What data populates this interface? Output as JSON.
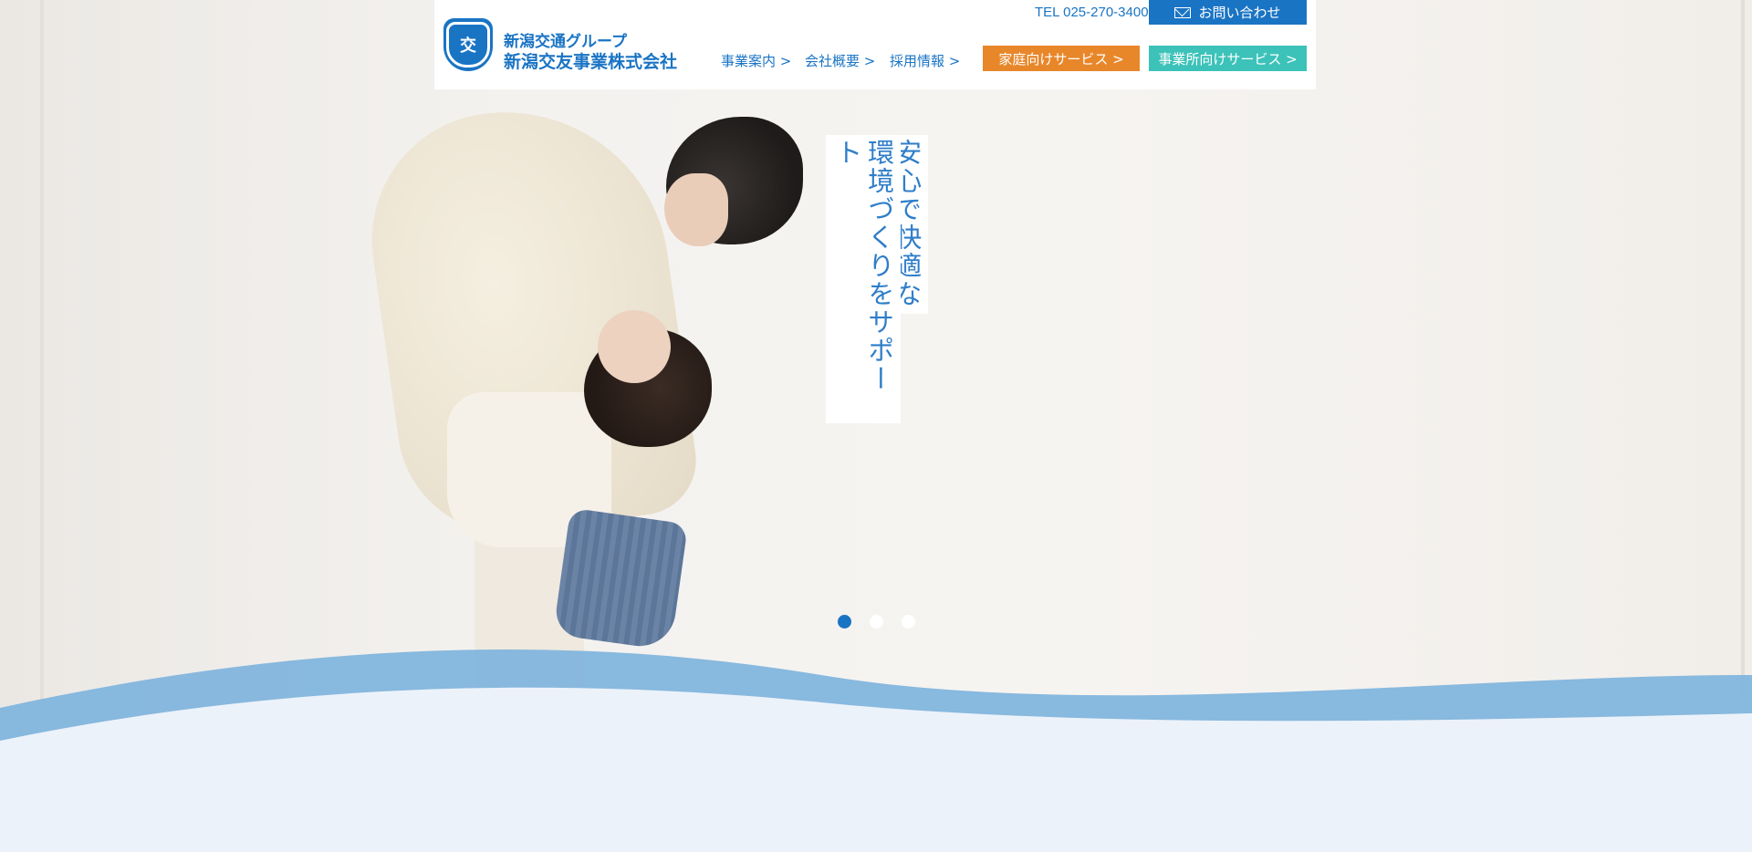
{
  "header": {
    "logo_emblem_text": "交",
    "logo_group": "新潟交通グループ",
    "logo_company": "新潟交友事業株式会社",
    "tel": "TEL 025-270-3400",
    "contact_label": "お問い合わせ",
    "nav": [
      {
        "label": "事業案内 >"
      },
      {
        "label": "会社概要 >"
      },
      {
        "label": "採用情報 >"
      }
    ],
    "home_service_label": "家庭向けサービス >",
    "business_service_label": "事業所向けサービス >"
  },
  "hero": {
    "catch_line1": "安心で快適な",
    "catch_line2": "環境づくりをサポート",
    "slides": 3,
    "active_slide": 1
  },
  "colors": {
    "brand_blue": "#1a74c4",
    "orange": "#e8872a",
    "teal": "#3cc2b9",
    "wave_blue": "#82b5dd",
    "wave_light": "#ecf2fa"
  }
}
